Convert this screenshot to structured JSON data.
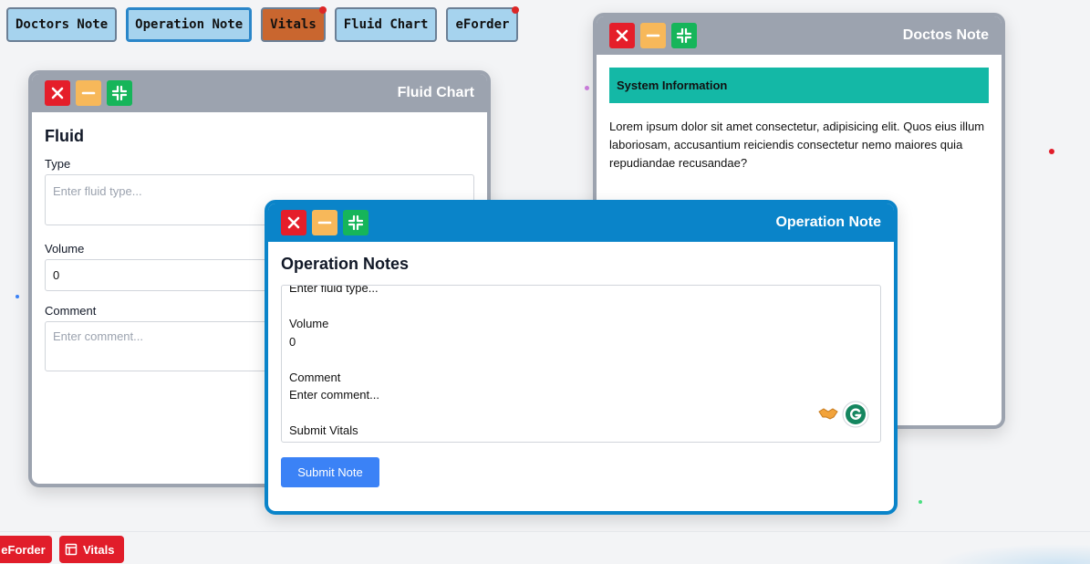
{
  "top_tabs": [
    {
      "label": "Doctors Note"
    },
    {
      "label": "Operation Note"
    },
    {
      "label": "Vitals"
    },
    {
      "label": "Fluid Chart"
    },
    {
      "label": "eForder"
    }
  ],
  "fluid_window": {
    "title": "Fluid Chart",
    "heading": "Fluid",
    "type_label": "Type",
    "type_placeholder": "Enter fluid type...",
    "volume_label": "Volume",
    "volume_value": "0",
    "comment_label": "Comment",
    "comment_placeholder": "Enter comment..."
  },
  "doctor_window": {
    "title": "Doctos Note",
    "info_heading": "System Information",
    "body_text": "Lorem ipsum dolor sit amet consectetur, adipisicing elit. Quos eius illum laboriosam, accusantium reiciendis consectetur nemo maiores quia repudiandae recusandae?"
  },
  "operation_window": {
    "title": "Operation Note",
    "heading": "Operation Notes",
    "content_lines": [
      "Enter fluid type...",
      "",
      "Volume",
      "0",
      "",
      "Comment",
      "Enter comment...",
      "",
      "Submit Vitals"
    ],
    "submit_label": "Submit Note"
  },
  "bottom_bar": {
    "items": [
      {
        "label": "eForder"
      },
      {
        "label": "Vitals"
      }
    ]
  },
  "colors": {
    "tab_bg": "#a6d3ee",
    "tab_alert_bg": "#c9662f",
    "window_header": "#9ca3af",
    "operation_header": "#0a84c9",
    "close": "#e51e2a",
    "minimize": "#f7b85a",
    "maximize": "#16b55a",
    "info_bar": "#14b8a6",
    "submit": "#3b82f6",
    "bottom_button": "#e11d2a"
  }
}
